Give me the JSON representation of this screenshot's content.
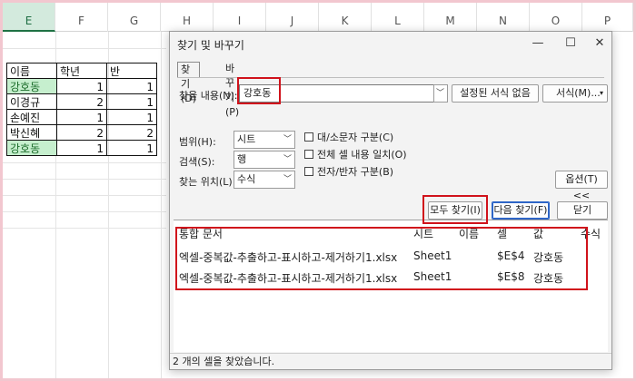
{
  "sheet": {
    "columns": [
      "E",
      "F",
      "G",
      "H",
      "I",
      "J",
      "K",
      "L",
      "M",
      "N",
      "O",
      "P"
    ],
    "headers": [
      "이름",
      "학년",
      "반"
    ],
    "rows": [
      {
        "name": "강호동",
        "grade": "1",
        "class": "1",
        "highlight": true
      },
      {
        "name": "이경규",
        "grade": "2",
        "class": "1",
        "highlight": false
      },
      {
        "name": "손예진",
        "grade": "1",
        "class": "1",
        "highlight": false
      },
      {
        "name": "박신혜",
        "grade": "2",
        "class": "2",
        "highlight": false
      },
      {
        "name": "강호동",
        "grade": "1",
        "class": "1",
        "highlight": true
      }
    ]
  },
  "dialog": {
    "title": "찾기 및 바꾸기",
    "min": "—",
    "max": "☐",
    "close": "✕",
    "tabs": [
      "찾기(D)",
      "바꾸기(P)"
    ],
    "find_label": "찾을 내용(N):",
    "find_value": "강호동",
    "format_none_label": "설정된 서식 없음",
    "format_label": "서식(M)...",
    "scope_label": "범위(H):",
    "scope_value": "시트",
    "search_label": "검색(S):",
    "search_value": "행",
    "lookin_label": "찾는 위치(L):",
    "lookin_value": "수식",
    "options": [
      {
        "label": "대/소문자 구분(C)",
        "checked": false
      },
      {
        "label": "전체 셀 내용 일치(O)",
        "checked": false
      },
      {
        "label": "전자/반자 구분(B)",
        "checked": false
      }
    ],
    "options_button": "옵션(T) <<",
    "find_all_label": "모두 찾기(I)",
    "find_next_label": "다음 찾기(F)",
    "close_label": "닫기",
    "results": {
      "headers": [
        "통합 문서",
        "시트",
        "이름",
        "셀",
        "값",
        "수식"
      ],
      "rows": [
        {
          "book": "엑셀-중복값-추출하고-표시하고-제거하기1.xlsx",
          "sheet": "Sheet1",
          "name": "",
          "cell": "$E$4",
          "value": "강호동",
          "formula": ""
        },
        {
          "book": "엑셀-중복값-추출하고-표시하고-제거하기1.xlsx",
          "sheet": "Sheet1",
          "name": "",
          "cell": "$E$8",
          "value": "강호동",
          "formula": ""
        }
      ]
    },
    "status": "2 개의 셀을 찾았습니다."
  },
  "colors": {
    "highlight_fill": "#c6efce",
    "highlight_text": "#1b6c2a",
    "annotation_red": "#d0121b",
    "frame_pink": "#f2c7cf"
  }
}
